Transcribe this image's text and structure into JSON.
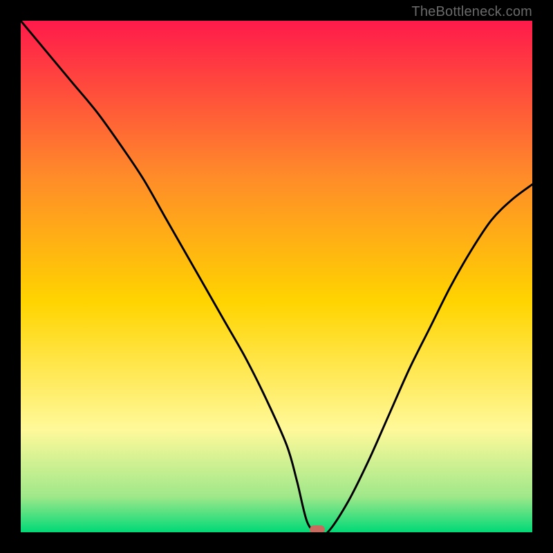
{
  "watermark": "TheBottleneck.com",
  "chart_data": {
    "type": "line",
    "title": "",
    "xlabel": "",
    "ylabel": "",
    "xlim": [
      0,
      100
    ],
    "ylim": [
      0,
      100
    ],
    "grid": false,
    "legend": false,
    "gradient_colors": {
      "top": "#ff1a4b",
      "mid_upper": "#ff8a2a",
      "mid": "#ffd400",
      "mid_lower": "#fff99a",
      "near_bottom": "#9fe88a",
      "bottom": "#00d977"
    },
    "series": [
      {
        "name": "bottleneck-curve",
        "color": "#000000",
        "x": [
          0,
          5,
          10,
          15,
          20,
          24,
          28,
          32,
          36,
          40,
          44,
          48,
          52,
          54,
          56,
          58,
          60,
          64,
          68,
          72,
          76,
          80,
          84,
          88,
          92,
          96,
          100
        ],
        "y": [
          100,
          94,
          88,
          82,
          75,
          69,
          62,
          55,
          48,
          41,
          34,
          26,
          17,
          10,
          2,
          0,
          0,
          6,
          14,
          23,
          32,
          40,
          48,
          55,
          61,
          65,
          68
        ]
      }
    ],
    "marker": {
      "name": "sweet-spot",
      "x": 58,
      "y": 0.5,
      "color": "#c96a5f"
    }
  }
}
